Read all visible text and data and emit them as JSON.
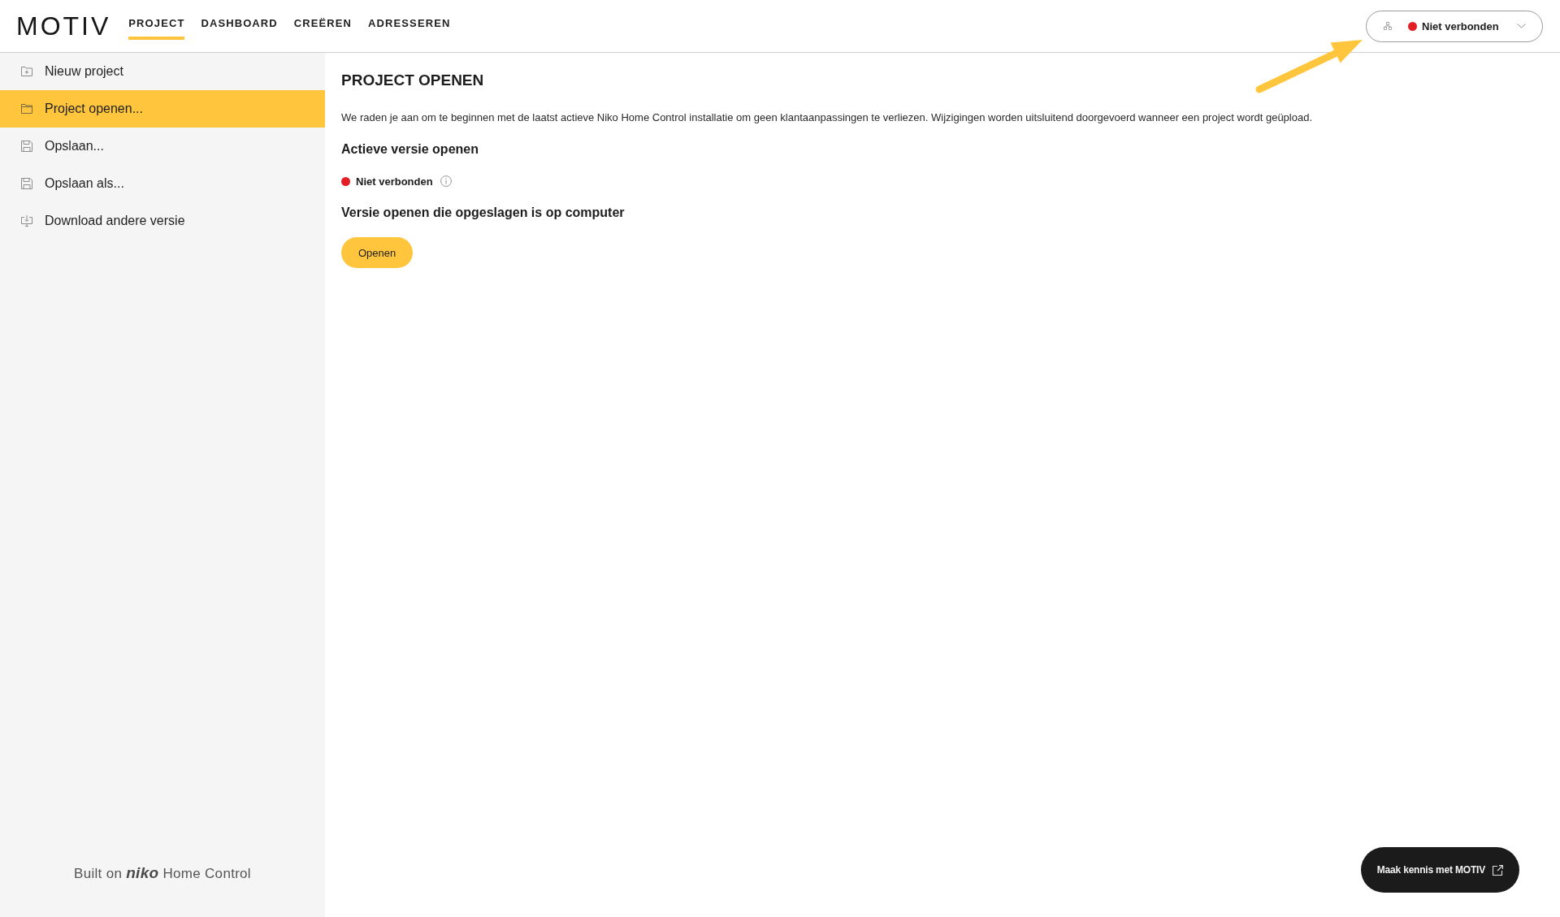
{
  "header": {
    "logo": "MOTIV",
    "nav": [
      {
        "label": "PROJECT",
        "selected": true
      },
      {
        "label": "DASHBOARD",
        "selected": false
      },
      {
        "label": "CREËREN",
        "selected": false
      },
      {
        "label": "ADRESSEREN",
        "selected": false
      }
    ],
    "connection": {
      "status": "Niet verbonden",
      "connected": false
    }
  },
  "sidebar": {
    "items": [
      {
        "label": "Nieuw project",
        "kind": "new",
        "selected": false
      },
      {
        "label": "Project openen...",
        "kind": "open",
        "selected": true
      },
      {
        "label": "Opslaan...",
        "kind": "save",
        "selected": false
      },
      {
        "label": "Opslaan als...",
        "kind": "save",
        "selected": false
      },
      {
        "label": "Download andere versie",
        "kind": "download",
        "selected": false
      }
    ],
    "footer": "Built on **niko** Home Control"
  },
  "main": {
    "title": "PROJECT OPENEN",
    "intro": "We raden je aan om te beginnen met de laatst actieve Niko Home Control installatie om geen klantaanpassingen te verliezen. Wijzigingen worden uitsluitend doorgevoerd wanneer een project wordt geüpload.",
    "active": {
      "heading": "Actieve versie openen",
      "status": "Niet verbonden",
      "connected": false
    },
    "local": {
      "heading": "Versie openen die opgeslagen is op computer",
      "button": "Openen"
    }
  },
  "promo_button": "Maak kennis met MOTIV"
}
